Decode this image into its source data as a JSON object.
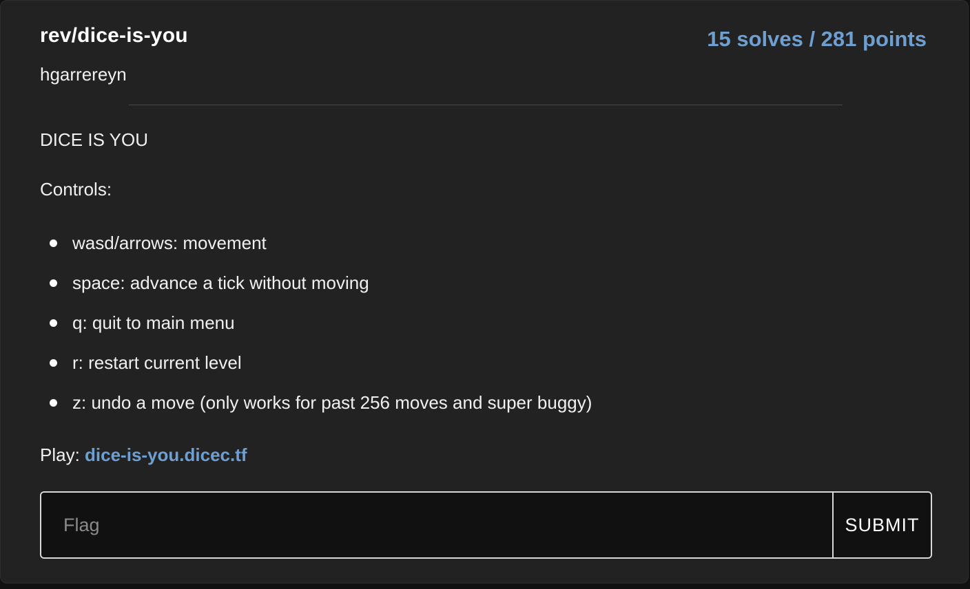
{
  "challenge": {
    "title": "rev/dice-is-you",
    "author": "hgarrereyn",
    "solves_points": "15 solves / 281 points"
  },
  "description": {
    "heading": "DICE IS YOU",
    "controls_label": "Controls:",
    "controls": [
      "wasd/arrows: movement",
      "space: advance a tick without moving",
      "q: quit to main menu",
      "r: restart current level",
      "z: undo a move (only works for past 256 moves and super buggy)"
    ],
    "play_prefix": "Play: ",
    "play_link": "dice-is-you.dicec.tf"
  },
  "flag_form": {
    "placeholder": "Flag",
    "value": "",
    "submit_label": "SUBMIT"
  },
  "colors": {
    "background": "#222222",
    "accent": "#6f9fd1",
    "text": "#f0f0f0"
  }
}
